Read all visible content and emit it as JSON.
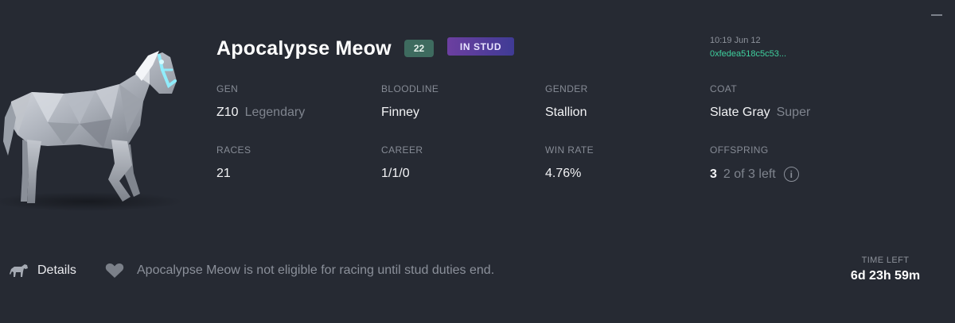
{
  "horse": {
    "name": "Apocalypse Meow",
    "number_badge": "22",
    "status_badge": "IN STUD"
  },
  "meta": {
    "timestamp": "10:19 Jun 12",
    "address": "0xfedea518c5c53..."
  },
  "stats": {
    "gen": {
      "label": "GEN",
      "value": "Z10",
      "sub": "Legendary"
    },
    "bloodline": {
      "label": "BLOODLINE",
      "value": "Finney"
    },
    "gender": {
      "label": "GENDER",
      "value": "Stallion"
    },
    "coat": {
      "label": "COAT",
      "value": "Slate Gray",
      "sub": "Super"
    },
    "races": {
      "label": "RACES",
      "value": "21"
    },
    "career": {
      "label": "CAREER",
      "value": "1/1/0"
    },
    "win_rate": {
      "label": "WIN RATE",
      "value": "4.76%"
    },
    "offspring": {
      "label": "OFFSPRING",
      "value": "3",
      "sub": "2 of 3 left",
      "info_icon": "i"
    }
  },
  "footer": {
    "details_label": "Details",
    "notice": "Apocalypse Meow is not eligible for racing until stud duties end.",
    "time_left_label": "TIME LEFT",
    "time_left_value": "6d 23h 59m"
  },
  "icons": {
    "minimize": "minimize-icon",
    "horse": "horse-icon",
    "heart": "heart-icon",
    "info": "info-icon"
  },
  "colors": {
    "background": "#262a33",
    "number_badge": "#3e6b5f",
    "stud_badge_start": "#6c3fa0",
    "stud_badge_end": "#3f3b95",
    "address": "#3fcf9e",
    "bridle_glow": "#8ff0ff"
  }
}
